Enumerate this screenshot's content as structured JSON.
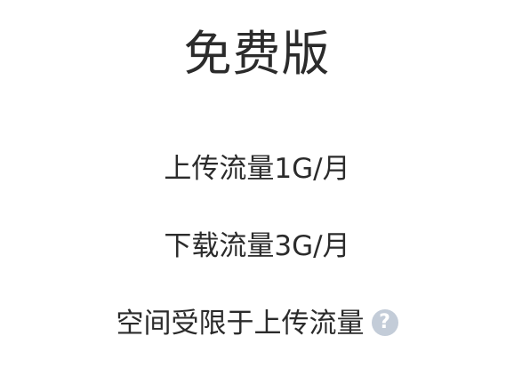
{
  "plan": {
    "title": "免费版",
    "features": [
      {
        "text": "上传流量1G/月"
      },
      {
        "text": "下载流量3G/月"
      },
      {
        "text": "空间受限于上传流量"
      }
    ],
    "help_icon": "question-mark-icon",
    "colors": {
      "text": "#2b2b2b",
      "help_icon_bg": "#c3ccd8"
    }
  }
}
